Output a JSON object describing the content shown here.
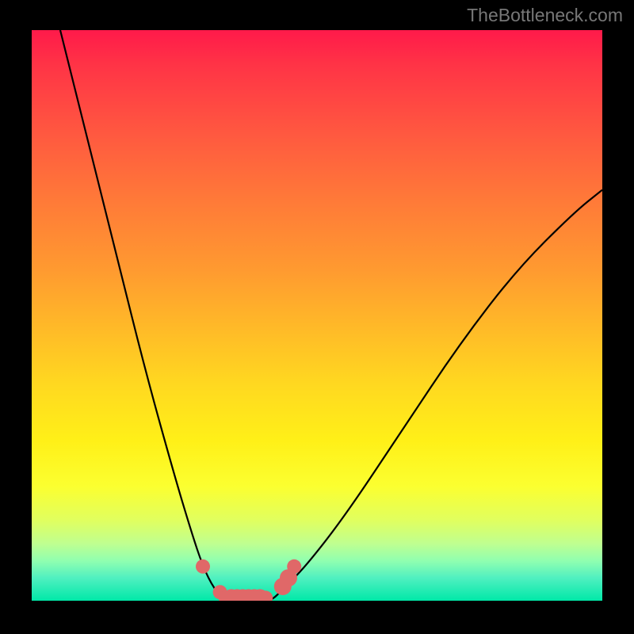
{
  "watermark": "TheBottleneck.com",
  "chart_data": {
    "type": "line",
    "title": "",
    "xlabel": "",
    "ylabel": "",
    "xlim": [
      0,
      100
    ],
    "ylim": [
      0,
      100
    ],
    "series": [
      {
        "name": "bottleneck-curve",
        "x": [
          5,
          10,
          15,
          20,
          25,
          28,
          30,
          32,
          34,
          36,
          38,
          40,
          42,
          44,
          48,
          55,
          65,
          75,
          85,
          95,
          100
        ],
        "values": [
          100,
          80,
          60,
          40,
          22,
          12,
          6,
          2,
          0,
          0,
          0,
          0,
          0,
          2,
          6,
          15,
          30,
          45,
          58,
          68,
          72
        ]
      }
    ],
    "markers": {
      "name": "data-points",
      "x": [
        30,
        33,
        34,
        35,
        36,
        37,
        38,
        39,
        40,
        41,
        44,
        45,
        46
      ],
      "y": [
        6,
        1.5,
        0.5,
        0.5,
        0.5,
        0.5,
        0.5,
        0.5,
        0.5,
        0.5,
        2.5,
        4,
        6
      ],
      "size": [
        9,
        9,
        9,
        11,
        11,
        11,
        11,
        11,
        11,
        9,
        11,
        11,
        9
      ]
    },
    "background_gradient": {
      "top": "#ff1a4a",
      "bottom": "#00e8a8"
    }
  }
}
